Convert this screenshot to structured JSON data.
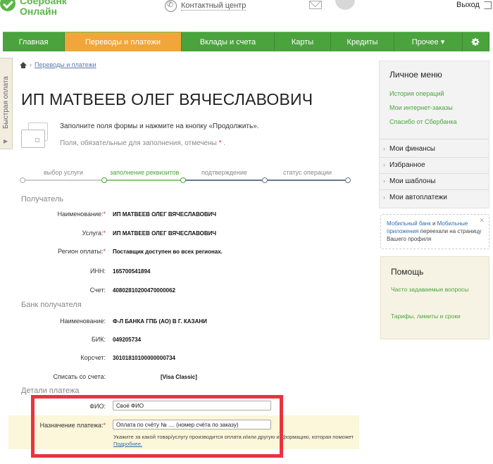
{
  "header": {
    "logo_line1": "Сбербанк",
    "logo_line2": "Онлайн",
    "contact_center": "Контактный центр",
    "exit": "Выход"
  },
  "nav": {
    "items": [
      {
        "label": "Главная"
      },
      {
        "label": "Переводы и платежи"
      },
      {
        "label": "Вклады и счета"
      },
      {
        "label": "Карты"
      },
      {
        "label": "Кредиты"
      },
      {
        "label": "Прочее ▾"
      }
    ],
    "active": "Переводы и платежи"
  },
  "quick_pay": {
    "label": "Быстрая оплата"
  },
  "breadcrumb": {
    "link": "Переводы и платежи"
  },
  "page_title": "ИП МАТВЕЕВ ОЛЕГ ВЯЧЕСЛАВОВИЧ",
  "info": {
    "line1": "Заполните поля формы и нажмите на кнопку «Продолжить».",
    "line2": "Поля, обязательные для заполнения, отмечены",
    "req_mark": "*",
    "line2_end": "."
  },
  "progress": {
    "steps": [
      "выбор услуги",
      "заполнение реквизитов",
      "подтверждение",
      "статус операции"
    ]
  },
  "recipient": {
    "section": "Получатель",
    "name_label": "Наименование:",
    "name": "ИП МАТВЕЕВ ОЛЕГ ВЯЧЕСЛАВОВИЧ",
    "service_label": "Услуга:",
    "service": "ИП МАТВЕЕВ ОЛЕГ ВЯЧЕСЛАВОВИЧ",
    "region_label": "Регион оплаты:",
    "region": "Поставщик доступен во всех регионах.",
    "inn_label": "ИНН:",
    "inn": "165700541894",
    "account_label": "Счет:",
    "account": "40802810200470000062"
  },
  "bank": {
    "section": "Банк получателя",
    "name_label": "Наименование:",
    "name": "Ф-Л БАНКА ГПБ (АО) В Г. КАЗАНИ",
    "bik_label": "БИК:",
    "bik": "049205734",
    "corr_label": "Корсчет:",
    "corr": "30101810100000000734",
    "debit_label": "Списать со счета:",
    "debit": "[Visa Classic]"
  },
  "payment": {
    "section": "Детали платежа",
    "fio_label": "ФИО:",
    "fio_value": "Своё ФИО",
    "purpose_label": "Назначение платежа:",
    "purpose_value": "Оплата по счёту № .... (номер счёта по заказу)",
    "hint": "Укажите за какой товар/услугу производится оплата и/или другую информацию, которая поможет",
    "hint_link": "Подробнее."
  },
  "personal_menu": {
    "title": "Личное меню",
    "links": [
      "История операций",
      "Мои интернет-заказы",
      "Спасибо от Сбербанка"
    ],
    "items": [
      "Мои финансы",
      "Избранное",
      "Мои шаблоны",
      "Мои автоплатежи"
    ]
  },
  "mobile_notice": {
    "link1": "Мобильный банк",
    "and": "и",
    "link2": "Мобильные приложения",
    "rest": "переехали на страницу Вашего профиля",
    "close": "✕"
  },
  "help": {
    "title": "Помощь",
    "links": [
      "Часто задаваемые вопросы",
      "Тарифы, лимиты и сроки"
    ]
  },
  "colors": {
    "brand_green": "#4aa33d",
    "nav_active": "#f0a63a",
    "highlight_frame": "#e8343e"
  }
}
